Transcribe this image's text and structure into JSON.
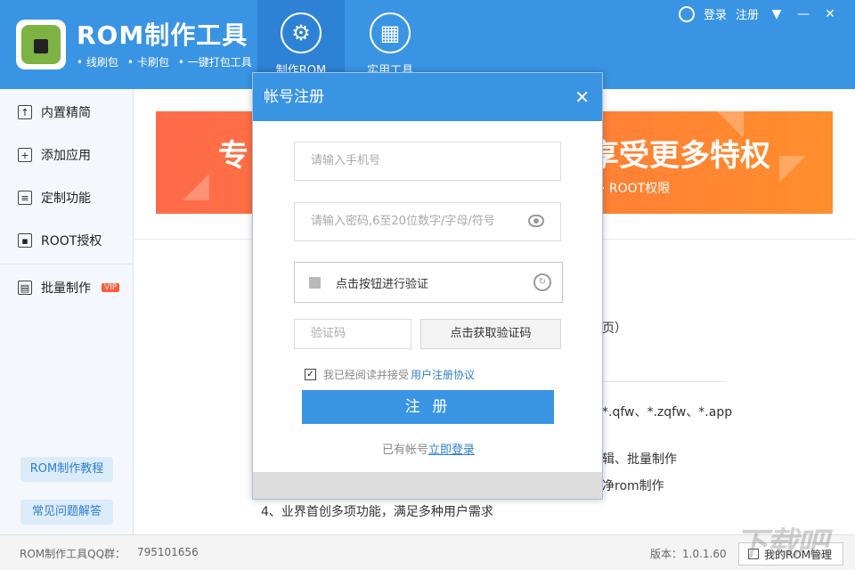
{
  "app": {
    "title": "ROM制作工具",
    "subtitles": [
      "线刷包",
      "卡刷包",
      "一键打包工具"
    ]
  },
  "nav": {
    "tabs": [
      {
        "label": "制作ROM",
        "icon": "gear-icon"
      },
      {
        "label": "实用工具",
        "icon": "grid-icon"
      }
    ]
  },
  "topbar": {
    "login": "登录",
    "register": "注册"
  },
  "sidebar": {
    "items": [
      {
        "label": "内置精简",
        "icon": "export-icon"
      },
      {
        "label": "添加应用",
        "icon": "plus-box-icon"
      },
      {
        "label": "定制功能",
        "icon": "settings-list-icon"
      },
      {
        "label": "ROOT授权",
        "icon": "lock-icon"
      },
      {
        "label": "批量制作",
        "icon": "batch-icon",
        "badge": "VIP"
      }
    ],
    "tutorial_button": "ROM制作教程",
    "faq_button": "常见问题解答"
  },
  "banner": {
    "left_text": "专",
    "right_text": "享受更多特权",
    "sub_text": "·  ROOT权限"
  },
  "main": {
    "line1": "页）",
    "line2": "*.qfw、*.zqfw、*.app",
    "line3": "辑、批量制作",
    "line4": "净rom制作",
    "line5": "4、业界首创多项功能，满足多种用户需求"
  },
  "footer": {
    "qq_label": "ROM制作工具QQ群：",
    "qq_number": "795101656",
    "version": "版本：1.0.1.60",
    "my_rom_button": "我的ROM管理",
    "watermark": "下载吧"
  },
  "modal": {
    "title": "帐号注册",
    "phone_placeholder": "请输入手机号",
    "password_placeholder": "请输入密码,6至20位数字/字母/符号",
    "captcha_text": "点击按钮进行验证",
    "code_placeholder": "验证码",
    "get_code_button": "点击获取验证码",
    "agree_text": "我已经阅读并接受",
    "agree_link": "用户注册协议",
    "agree_checked": true,
    "register_button": "注 册",
    "have_account_text": "已有帐号",
    "login_link": "立即登录"
  }
}
